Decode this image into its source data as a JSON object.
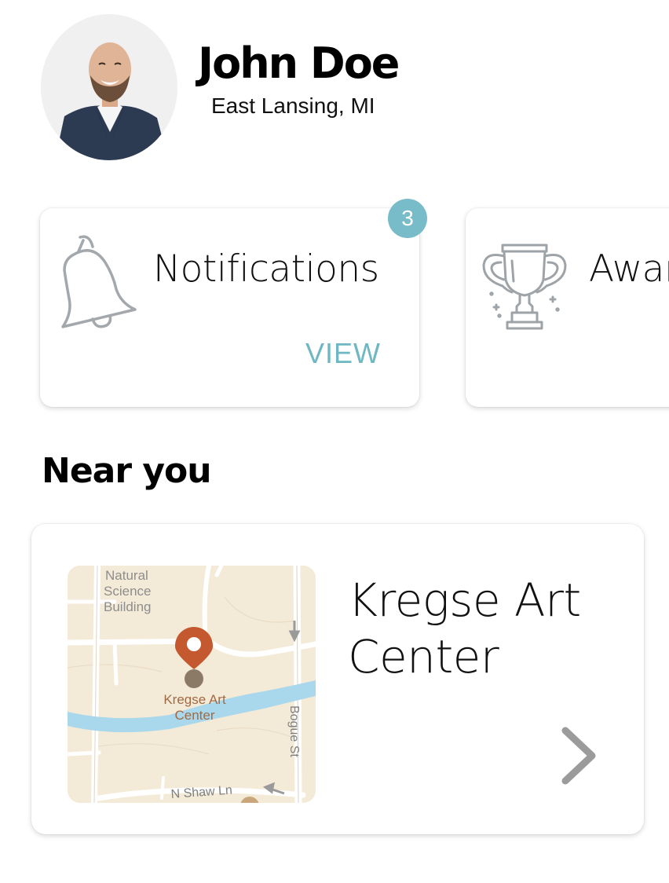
{
  "profile": {
    "name": "John Doe",
    "location": "East Lansing, MI"
  },
  "cards": {
    "notifications": {
      "title": "Notifications",
      "action_label": "VIEW",
      "badge_count": "3",
      "icon": "bell-icon"
    },
    "awards": {
      "title": "Awards",
      "icon": "trophy-icon"
    }
  },
  "near_you": {
    "section_title": "Near you",
    "place": {
      "name": "Kregse Art Center",
      "map": {
        "labels": {
          "building": "Natural Science Building",
          "pin_label": "Kregse Art Center",
          "street_1": "Bogue St",
          "street_2": "N Shaw Ln"
        }
      }
    }
  },
  "colors": {
    "accent": "#6fb7c2",
    "badge": "#77bcc8",
    "pin": "#c4582f",
    "map_bg": "#f4ead8",
    "river": "#a9d8ec"
  }
}
